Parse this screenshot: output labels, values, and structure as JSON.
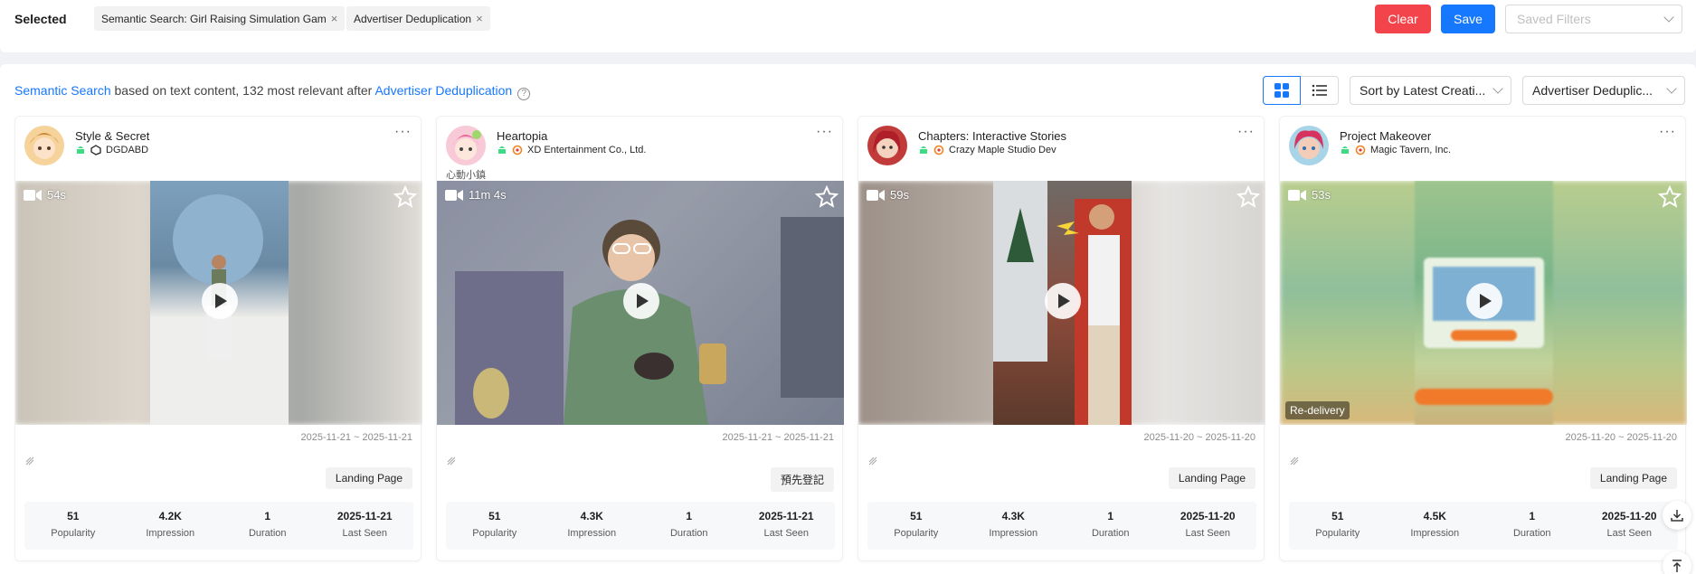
{
  "filters": {
    "label": "Selected",
    "chips": [
      "Semantic Search: Girl Raising Simulation Gam",
      "Advertiser Deduplication"
    ],
    "clear_label": "Clear",
    "save_label": "Save",
    "saved_filters_placeholder": "Saved Filters"
  },
  "summary": {
    "link1": "Semantic Search",
    "text1": " based on text content, 132 most relevant after ",
    "link2": "Advertiser Deduplication",
    "help": "?"
  },
  "toolbar": {
    "sort_label": "Sort by Latest Creati...",
    "dedup_label": "Advertiser Deduplic..."
  },
  "cards": [
    {
      "name": "Style & Secret",
      "publisher": "DGDABD",
      "subtitle": "",
      "duration": "54s",
      "date_range": "2025-11-21 ~ 2025-11-21",
      "landing": "Landing Page",
      "redelivery": "",
      "stats": [
        {
          "value": "51",
          "label": "Popularity"
        },
        {
          "value": "4.2K",
          "label": "Impression"
        },
        {
          "value": "1",
          "label": "Duration"
        },
        {
          "value": "2025-11-21",
          "label": "Last Seen"
        }
      ]
    },
    {
      "name": "Heartopia",
      "publisher": "XD Entertainment Co., Ltd.",
      "subtitle": "心動小鎮",
      "duration": "11m 4s",
      "date_range": "2025-11-21 ~ 2025-11-21",
      "landing": "預先登記",
      "redelivery": "",
      "stats": [
        {
          "value": "51",
          "label": "Popularity"
        },
        {
          "value": "4.3K",
          "label": "Impression"
        },
        {
          "value": "1",
          "label": "Duration"
        },
        {
          "value": "2025-11-21",
          "label": "Last Seen"
        }
      ]
    },
    {
      "name": "Chapters: Interactive Stories",
      "publisher": "Crazy Maple Studio Dev",
      "subtitle": "",
      "duration": "59s",
      "date_range": "2025-11-20 ~ 2025-11-20",
      "landing": "Landing Page",
      "redelivery": "",
      "stats": [
        {
          "value": "51",
          "label": "Popularity"
        },
        {
          "value": "4.3K",
          "label": "Impression"
        },
        {
          "value": "1",
          "label": "Duration"
        },
        {
          "value": "2025-11-20",
          "label": "Last Seen"
        }
      ]
    },
    {
      "name": "Project Makeover",
      "publisher": "Magic Tavern, Inc.",
      "subtitle": "",
      "duration": "53s",
      "date_range": "2025-11-20 ~ 2025-11-20",
      "landing": "Landing Page",
      "redelivery": "Re-delivery",
      "stats": [
        {
          "value": "51",
          "label": "Popularity"
        },
        {
          "value": "4.5K",
          "label": "Impression"
        },
        {
          "value": "1",
          "label": "Duration"
        },
        {
          "value": "2025-11-20",
          "label": "Last Seen"
        }
      ]
    }
  ],
  "colors": {
    "accent": "#1677ff",
    "danger": "#f3434b",
    "android": "#3ddc84"
  }
}
